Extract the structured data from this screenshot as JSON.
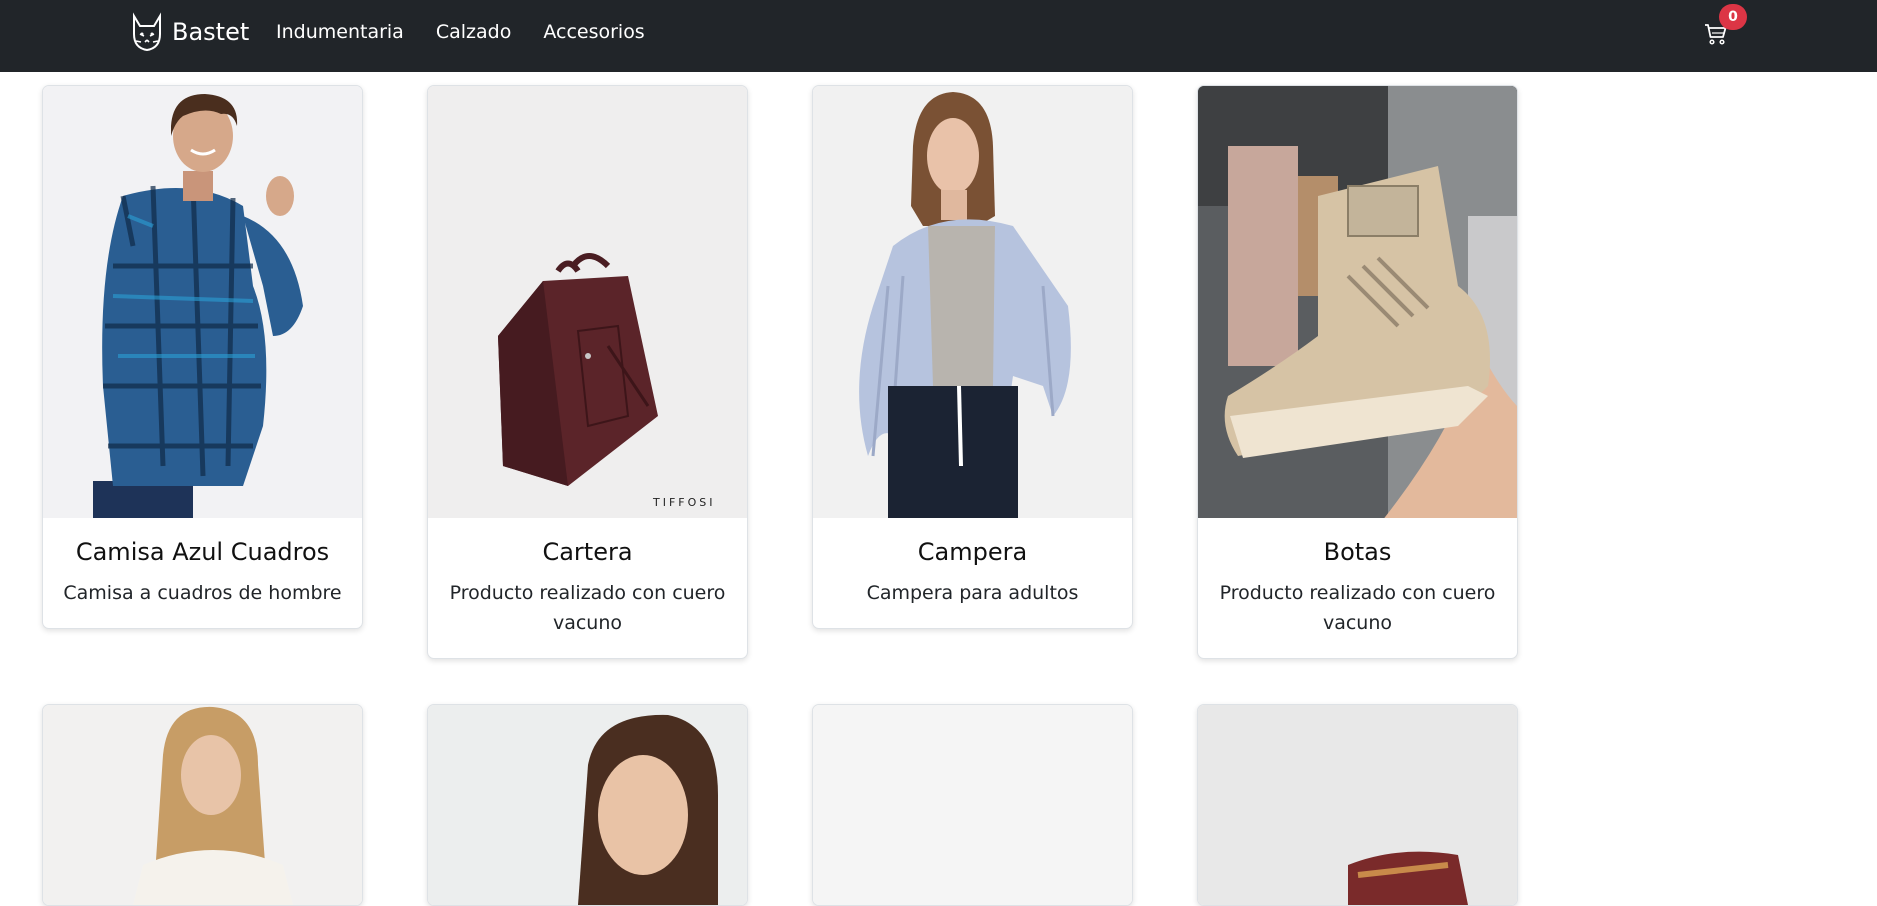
{
  "brand": {
    "name": "Bastet",
    "logo_icon": "cat-logo-icon"
  },
  "nav": {
    "links": [
      {
        "label": "Indumentaria"
      },
      {
        "label": "Calzado"
      },
      {
        "label": "Accesorios"
      }
    ],
    "cart": {
      "icon": "cart-icon",
      "count": "0"
    }
  },
  "products": [
    {
      "title": "Camisa Azul Cuadros",
      "description": "Camisa a cuadros de hombre",
      "image": "man-plaid-shirt"
    },
    {
      "title": "Cartera",
      "description": "Producto realizado con cuero vacuno",
      "image": "burgundy-handbag",
      "image_watermark": "TIFFOSI"
    },
    {
      "title": "Campera",
      "description": "Campera para adultos",
      "image": "woman-light-blue-puffer-jacket"
    },
    {
      "title": "Botas",
      "description": "Producto realizado con cuero vacuno",
      "image": "beige-boot-in-hand"
    }
  ],
  "products_row2": [
    {
      "image": "woman-white-top"
    },
    {
      "image": "woman-portrait"
    },
    {
      "image": "blank-grey"
    },
    {
      "image": "patterned-shoe"
    }
  ],
  "colors": {
    "navbar": "#212529",
    "badge": "#dc3545"
  }
}
